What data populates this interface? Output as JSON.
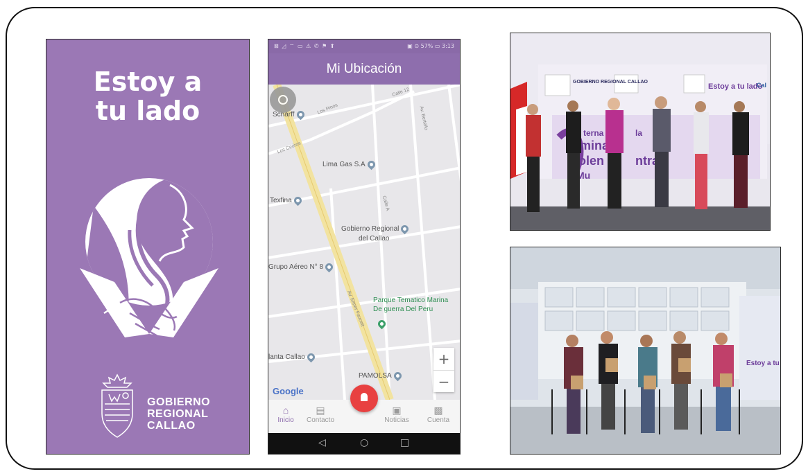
{
  "splash": {
    "title_line1": "Estoy a",
    "title_line2": "tu lado",
    "org_line1": "GOBIERNO",
    "org_line2": "REGIONAL",
    "org_line3": "CALLAO",
    "bg_color": "#9b78b5"
  },
  "phone": {
    "status_left": "⊠ ◿ ⌔ ▭ ⚠ ✆ ⚑ ⬆",
    "status_right": "▣ ⊙ 57% ▭ 3:13",
    "title": "Mi Ubicación",
    "map_labels": [
      "Scharff",
      "Lima Gas S.A",
      "Texfina",
      "Gobierno Regional",
      "del Callao",
      "Grupo Aéreo N° 8",
      "Parque Tematico Marina",
      "De guerra Del Peru",
      "lanta Callao",
      "PAMOLSA",
      "Los Cedros",
      "Los Pinos",
      "Av. Elmer Faucett",
      "Calle A",
      "Calle 12",
      "Av. Bertello"
    ],
    "google_label": "Google",
    "zoom_in": "+",
    "zoom_out": "−",
    "nav": [
      {
        "label": "Inicio",
        "icon": "home-icon"
      },
      {
        "label": "Contacto",
        "icon": "contact-icon"
      },
      {
        "label": "Noticias",
        "icon": "news-icon"
      },
      {
        "label": "Cuenta",
        "icon": "account-icon"
      }
    ],
    "accent_color": "#8e6ead",
    "alert_color": "#e84040"
  },
  "photo_top": {
    "banner_1": "GOBIERNO REGIONAL CALLAO",
    "banner_2": "Estoy a tu lado",
    "banner_text_1": "terna",
    "banner_text_2": "mina",
    "banner_text_3": "olen",
    "banner_text_4": "Mu",
    "banner_text_5": "la",
    "banner_text_6": "ntra",
    "banner_text_7": "Cal"
  },
  "photo_bottom": {
    "banner_2": "Estoy a tu lado"
  }
}
